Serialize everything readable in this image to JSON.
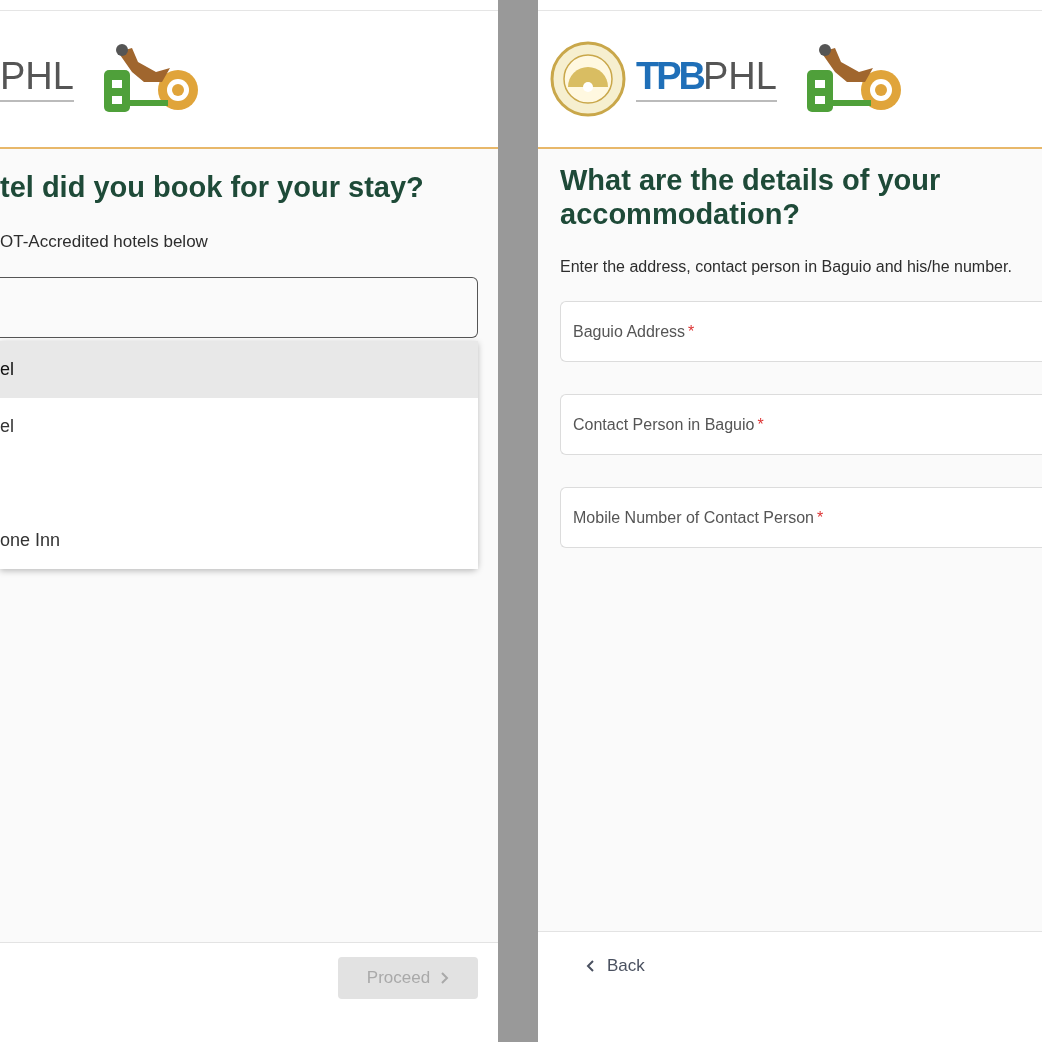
{
  "left_panel": {
    "logo_text": "PHL",
    "title": "tel did you book for your stay?",
    "subtitle": "OT-Accredited hotels below",
    "options": [
      {
        "label": "el",
        "selected": true
      },
      {
        "label": "el",
        "selected": false
      },
      {
        "selected": false
      },
      {
        "label": "one Inn",
        "selected": false
      }
    ],
    "proceed_button": {
      "label": "Proceed",
      "disabled": true
    }
  },
  "right_panel": {
    "logo_text_a": "TPB",
    "logo_text_b": "PHL",
    "title": "What are the details of your accommodation?",
    "description": "Enter the address, contact person in Baguio and his/he number.",
    "fields": [
      {
        "placeholder": "Baguio Address",
        "required_mark": "*"
      },
      {
        "placeholder": "Contact Person in Baguio",
        "required_mark": "*"
      },
      {
        "placeholder": "Mobile Number of Contact Person",
        "required_mark": "*"
      }
    ],
    "back_button": {
      "label": "Back"
    }
  }
}
